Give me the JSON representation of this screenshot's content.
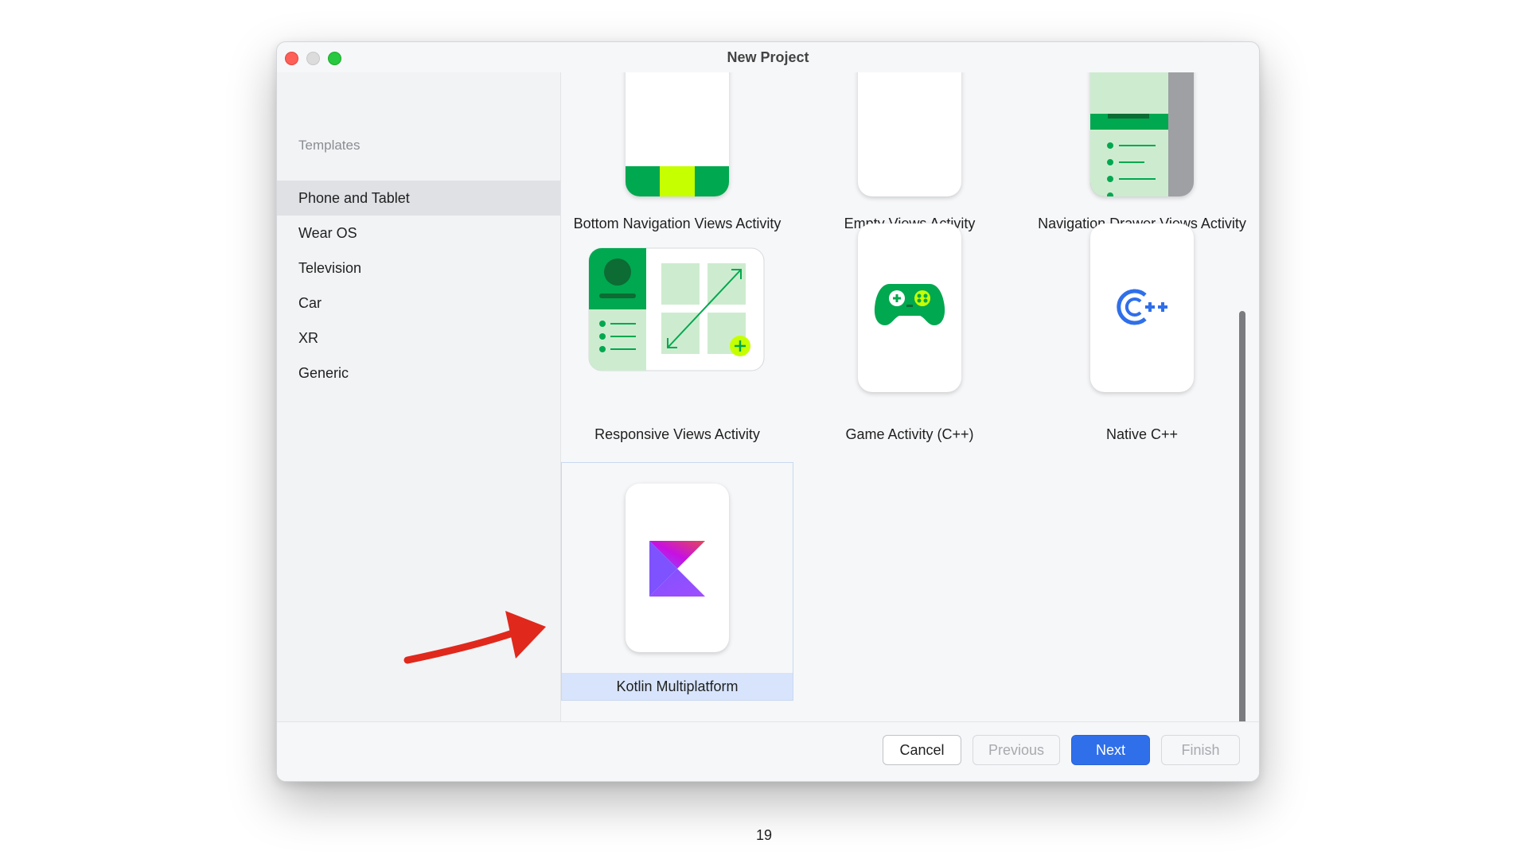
{
  "window": {
    "title": "New Project"
  },
  "sidebar": {
    "header": "Templates",
    "items": [
      {
        "label": "Phone and Tablet",
        "selected": true
      },
      {
        "label": "Wear OS"
      },
      {
        "label": "Television"
      },
      {
        "label": "Car"
      },
      {
        "label": "XR"
      },
      {
        "label": "Generic"
      }
    ]
  },
  "templates": [
    {
      "label": "Bottom Navigation Views Activity",
      "icon": "bottom-navigation-icon"
    },
    {
      "label": "Empty Views Activity",
      "icon": "empty-activity-icon"
    },
    {
      "label": "Navigation Drawer Views Activity",
      "icon": "navigation-drawer-icon"
    },
    {
      "label": "Responsive Views Activity",
      "icon": "responsive-activity-icon"
    },
    {
      "label": "Game Activity (C++)",
      "icon": "gamepad-icon"
    },
    {
      "label": "Native C++",
      "icon": "cpp-icon"
    },
    {
      "label": "Kotlin Multiplatform",
      "icon": "kotlin-logo-icon",
      "selected": true
    }
  ],
  "footer": {
    "cancel": "Cancel",
    "previous": "Previous",
    "next": "Next",
    "finish": "Finish"
  },
  "page_number": "19",
  "colors": {
    "accent": "#2f6fea",
    "android_green": "#00a84f",
    "lime": "#c6ff00",
    "annotation_arrow": "#e0281c"
  }
}
